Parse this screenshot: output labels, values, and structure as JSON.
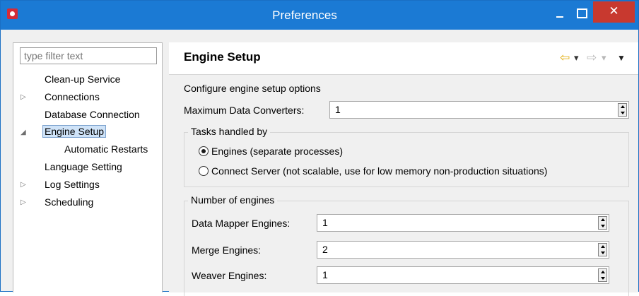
{
  "window": {
    "title": "Preferences",
    "close_glyph": "✕"
  },
  "filter": {
    "placeholder": "type filter text"
  },
  "tree": [
    {
      "label": "Clean-up Service"
    },
    {
      "label": "Connections",
      "twisty": "▷"
    },
    {
      "label": "Database Connection"
    },
    {
      "label": "Engine Setup",
      "twisty": "◢"
    },
    {
      "label": "Automatic Restarts"
    },
    {
      "label": "Language Setting"
    },
    {
      "label": "Log Settings",
      "twisty": "▷"
    },
    {
      "label": "Scheduling",
      "twisty": "▷"
    }
  ],
  "page": {
    "title": "Engine Setup",
    "description": "Configure engine setup options",
    "nav": {
      "back": "⇦",
      "back_menu": "▾",
      "forward": "⇨",
      "forward_menu": "▾",
      "view_menu": "▼"
    },
    "max_converters": {
      "label": "Maximum Data Converters:",
      "value": "1"
    },
    "tasks": {
      "label": "Tasks handled by",
      "options": [
        {
          "label": "Engines (separate processes)",
          "selected": true
        },
        {
          "label": "Connect Server (not scalable, use for low memory non-production situations)",
          "selected": false
        }
      ]
    },
    "engines": {
      "label": "Number of engines",
      "fields": [
        {
          "label": "Data Mapper Engines:",
          "value": "1"
        },
        {
          "label": "Merge Engines:",
          "value": "2"
        },
        {
          "label": "Weaver Engines:",
          "value": "1"
        }
      ]
    }
  },
  "colors": {
    "titlebar": "#1b7ad4",
    "close": "#c8392f",
    "selection": "#cfe3f8",
    "nav_arrow": "#e0a800"
  }
}
